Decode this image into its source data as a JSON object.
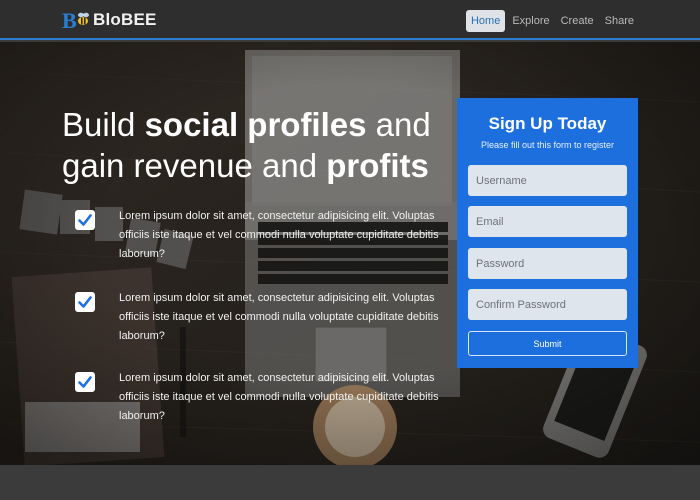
{
  "brand": {
    "name": "BloBEE"
  },
  "nav": {
    "items": [
      "Home",
      "Explore",
      "Create",
      "Share"
    ],
    "active": "Home"
  },
  "hero": {
    "headline_part1": "Build ",
    "headline_bold1": "social profiles",
    "headline_part2": " and gain revenue and ",
    "headline_bold2": "profits",
    "features": [
      "Lorem ipsum dolor sit amet, consectetur adipisicing elit. Voluptas officiis iste itaque et vel commodi nulla voluptate cupiditate debitis laborum?",
      "Lorem ipsum dolor sit amet, consectetur adipisicing elit. Voluptas officiis iste itaque et vel commodi nulla voluptate cupiditate debitis laborum?",
      "Lorem ipsum dolor sit amet, consectetur adipisicing elit. Voluptas officiis iste itaque et vel commodi nulla voluptate cupiditate debitis laborum?"
    ]
  },
  "signup": {
    "title": "Sign Up Today",
    "subtitle": "Please fill out this form to register",
    "username_placeholder": "Username",
    "email_placeholder": "Email",
    "password_placeholder": "Password",
    "confirm_placeholder": "Confirm Password",
    "submit_label": "Submit"
  },
  "colors": {
    "accent": "#1c6fdc",
    "nav_border": "#2d7bd3",
    "navbar_bg": "#2e2e2e"
  },
  "icons": {
    "brand_logo": "bee-logo-icon",
    "check": "checkmark-icon"
  }
}
